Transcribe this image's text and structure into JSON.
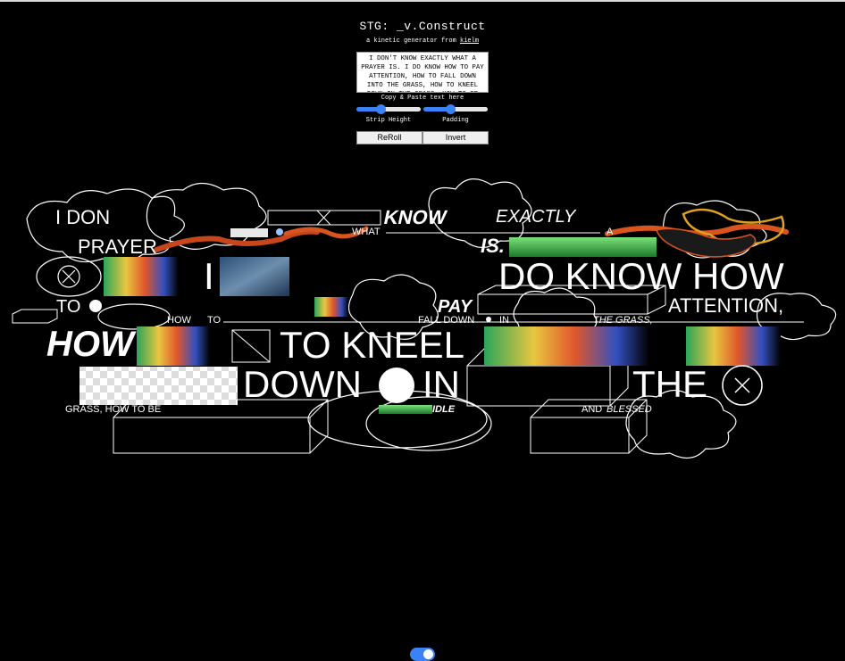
{
  "app": {
    "title": "STG: _v.Construct",
    "subtitle_prefix": "a kinetic generator from",
    "author_link": "kielm"
  },
  "controls": {
    "text_input_value": "I DON'T KNOW EXACTLY WHAT A PRAYER IS. I DO KNOW HOW TO PAY ATTENTION, HOW TO FALL DOWN INTO THE GRASS, HOW TO KNEEL DOWN IN THE GRASS, HOW TO BE IDLE AND BLESSED",
    "text_input_label": "Copy & Paste text here",
    "strip_height_label": "Strip Height",
    "strip_height_value": 0.38,
    "padding_label": "Padding",
    "padding_value": 0.4,
    "reroll_label": "ReRoll",
    "invert_label": "Invert"
  },
  "canvas": {
    "words": {
      "i_don": "I DON",
      "know": "KNOW",
      "exactly": "EXACTLY",
      "prayer": "PRAYER",
      "what": "WHAT",
      "a_small": "A",
      "is": "IS.",
      "i": "I",
      "do_know_how": "DO KNOW HOW",
      "to_dot": "TO",
      "pay": "PAY",
      "attention": "ATTENTION,",
      "how_small": "HOW",
      "to_small": "TO",
      "fall_down": "FALL DOWN",
      "in_small": "IN",
      "the_grass": "THE GRASS,",
      "how_big": "HOW",
      "to_kneel": "TO KNEEL",
      "down": "DOWN",
      "in_big": "IN",
      "the_big": "THE",
      "grass_how_to_be": "GRASS, HOW TO BE",
      "idle": "IDLE",
      "and": "AND",
      "blessed": "BLESSED"
    }
  },
  "footer": {
    "toggle_on": true
  },
  "colors": {
    "background": "#000000",
    "accent": "#3b82f6",
    "line": "#ffffff",
    "stroke_orange": "#d9541e",
    "stroke_yellow": "#e0a21c"
  }
}
